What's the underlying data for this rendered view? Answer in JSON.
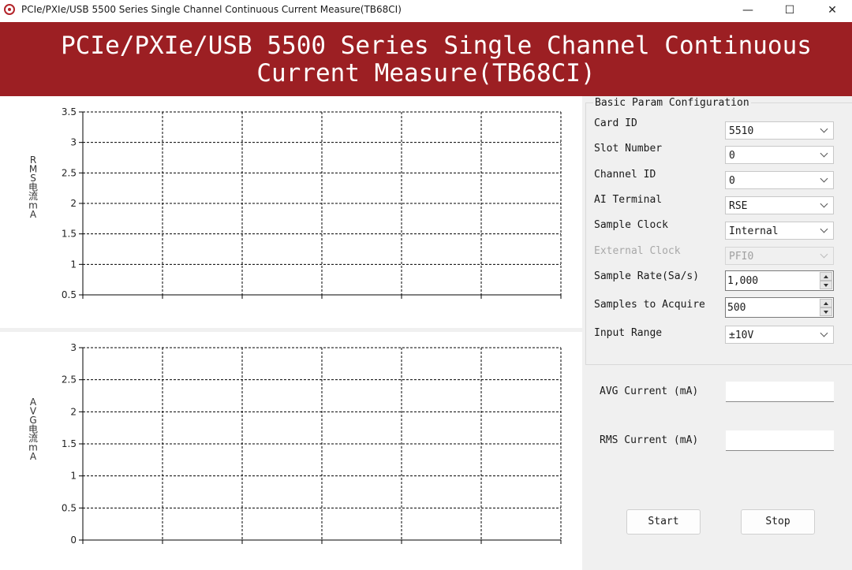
{
  "window": {
    "title": "PCIe/PXIe/USB 5500 Series Single Channel Continuous Current Measure(TB68CI)",
    "minimize_glyph": "—",
    "maximize_glyph": "☐",
    "close_glyph": "✕"
  },
  "banner": {
    "line1": "PCIe/PXIe/USB 5500 Series Single Channel Continuous",
    "line2": "Current Measure(TB68CI)"
  },
  "chart_data": [
    {
      "type": "line",
      "ylabel": "RMS电流mA",
      "ylim": [
        0.5,
        3.5
      ],
      "yticks": [
        "3.5",
        "3",
        "2.5",
        "2",
        "1.5",
        "1",
        "0.5"
      ],
      "x_divisions": 6,
      "series": [],
      "grid": true,
      "grid_style": "dashed"
    },
    {
      "type": "line",
      "ylabel": "AVG电流mA",
      "ylim": [
        0,
        3
      ],
      "yticks": [
        "3",
        "2.5",
        "2",
        "1.5",
        "1",
        "0.5",
        "0"
      ],
      "x_divisions": 6,
      "series": [],
      "grid": true,
      "grid_style": "dashed"
    }
  ],
  "config": {
    "group_title": "Basic Param Configuration",
    "fields": [
      {
        "label": "Card ID",
        "value": "5510"
      },
      {
        "label": "Slot Number",
        "value": "0"
      },
      {
        "label": "Channel ID",
        "value": "0"
      },
      {
        "label": "AI Terminal",
        "value": "RSE"
      },
      {
        "label": "Sample Clock",
        "value": "Internal"
      },
      {
        "label": "External Clock",
        "value": "PFI0"
      },
      {
        "label": "Sample Rate(Sa/s)",
        "value": "1,000"
      },
      {
        "label": "Samples to Acquire",
        "value": "500"
      },
      {
        "label": "Input Range",
        "value": "±10V"
      }
    ]
  },
  "results": {
    "avg_label": "AVG Current (mA)",
    "avg_value": "",
    "rms_label": "RMS Current (mA)",
    "rms_value": ""
  },
  "actions": {
    "start_label": "Start",
    "stop_label": "Stop"
  },
  "colors": {
    "banner": "#9c1f23",
    "panel": "#f0f0f0"
  }
}
